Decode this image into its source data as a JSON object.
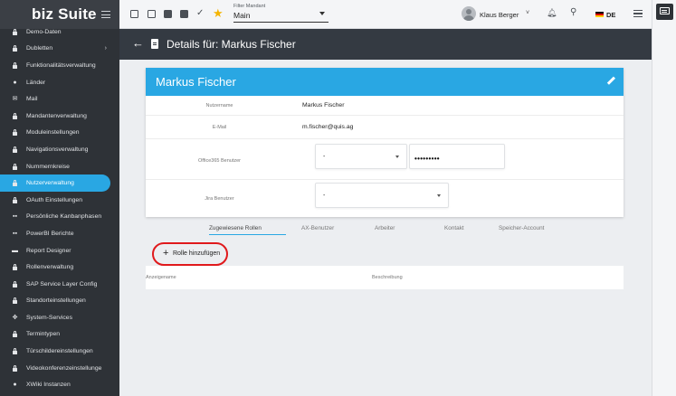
{
  "brand": {
    "name_part1": "biz",
    "name_part2": " Suite"
  },
  "sidebar": {
    "items": [
      {
        "label": "Demo-Daten",
        "icon": "lock-icon"
      },
      {
        "label": "Dubletten",
        "icon": "lock-icon",
        "chevron": "›"
      },
      {
        "label": "Funktionalitätsverwaltung",
        "icon": "lock-icon"
      },
      {
        "label": "Länder",
        "icon": "globe-icon"
      },
      {
        "label": "Mail",
        "icon": "mail-icon"
      },
      {
        "label": "Mandantenverwaltung",
        "icon": "lock-icon"
      },
      {
        "label": "Moduleinstellungen",
        "icon": "lock-icon"
      },
      {
        "label": "Navigationsverwaltung",
        "icon": "lock-icon"
      },
      {
        "label": "Nummernkreise",
        "icon": "lock-icon"
      },
      {
        "label": "Nutzerverwaltung",
        "icon": "lock-icon",
        "active": true
      },
      {
        "label": "OAuth Einstellungen",
        "icon": "lock-icon"
      },
      {
        "label": "Persönliche Kanbanphasen",
        "icon": "grid-icon"
      },
      {
        "label": "PowerBI Berichte",
        "icon": "grid-icon"
      },
      {
        "label": "Report Designer",
        "icon": "folder-icon"
      },
      {
        "label": "Rollenverwaltung",
        "icon": "lock-icon"
      },
      {
        "label": "SAP Service Layer Config",
        "icon": "lock-icon"
      },
      {
        "label": "Standorteinstellungen",
        "icon": "lock-icon"
      },
      {
        "label": "System-Services",
        "icon": "nodes-icon"
      },
      {
        "label": "Termintypen",
        "icon": "lock-icon"
      },
      {
        "label": "Türschildereinstellungen",
        "icon": "lock-icon"
      },
      {
        "label": "Videokonferenzeinstellunge",
        "icon": "lock-icon"
      },
      {
        "label": "XWiki Instanzen",
        "icon": "globe-icon"
      }
    ]
  },
  "topbar": {
    "filter_label": "Filter Mandant",
    "filter_value": "Main",
    "user_name": "Klaus Berger",
    "user_caret": "˅",
    "language": "DE"
  },
  "header": {
    "back": "←",
    "title": "Details für: Markus Fischer"
  },
  "card": {
    "title": "Markus Fischer",
    "rows": {
      "username_label": "Nutzername",
      "username_value": "Markus Fischer",
      "email_label": "E-Mail",
      "email_value": "m.fischer@quis.ag",
      "office_label": "Office365 Benutzer",
      "office_value": "-",
      "office_password": "•••••••••",
      "jira_label": "Jira Benutzer",
      "jira_value": "-"
    }
  },
  "tabs": [
    "Zugewiesene Rollen",
    "AX-Benutzer",
    "Arbeiter",
    "Kontakt",
    "Speicher-Account"
  ],
  "roles": {
    "add_label": "Rolle hinzufügen",
    "add_plus": "+",
    "col_display": "Anzeigename",
    "col_desc": "Beschreibung"
  },
  "colors": {
    "accent": "#29a7e3",
    "sidebar": "#2e3237",
    "header": "#343a42",
    "highlight": "#e0191c"
  }
}
